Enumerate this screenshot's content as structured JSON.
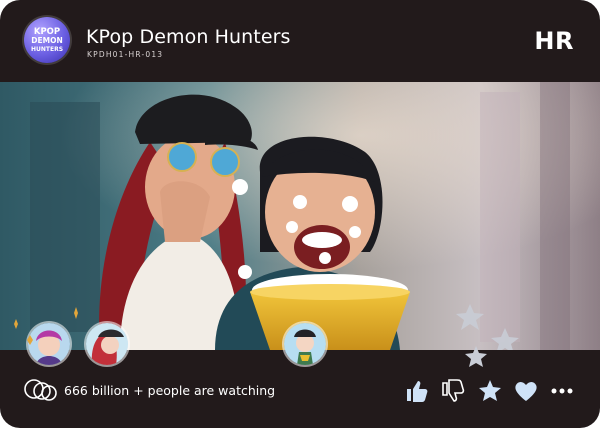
{
  "card": {
    "title": "KPop Demon Hunters",
    "code": "KPDH01-HR-013",
    "rarity": "HR",
    "logo_text": [
      "KPOP",
      "DEMON",
      "HUNTERS"
    ]
  },
  "footer": {
    "viewers_text": "666 billion + people are watching",
    "actions": [
      "thumbs-up-icon",
      "thumbs-down-icon",
      "star-icon",
      "heart-icon",
      "more-icon"
    ]
  },
  "colors": {
    "card_background": "#221a1b",
    "text": "#ffffff",
    "logo_purple": "#6b5fe2"
  }
}
